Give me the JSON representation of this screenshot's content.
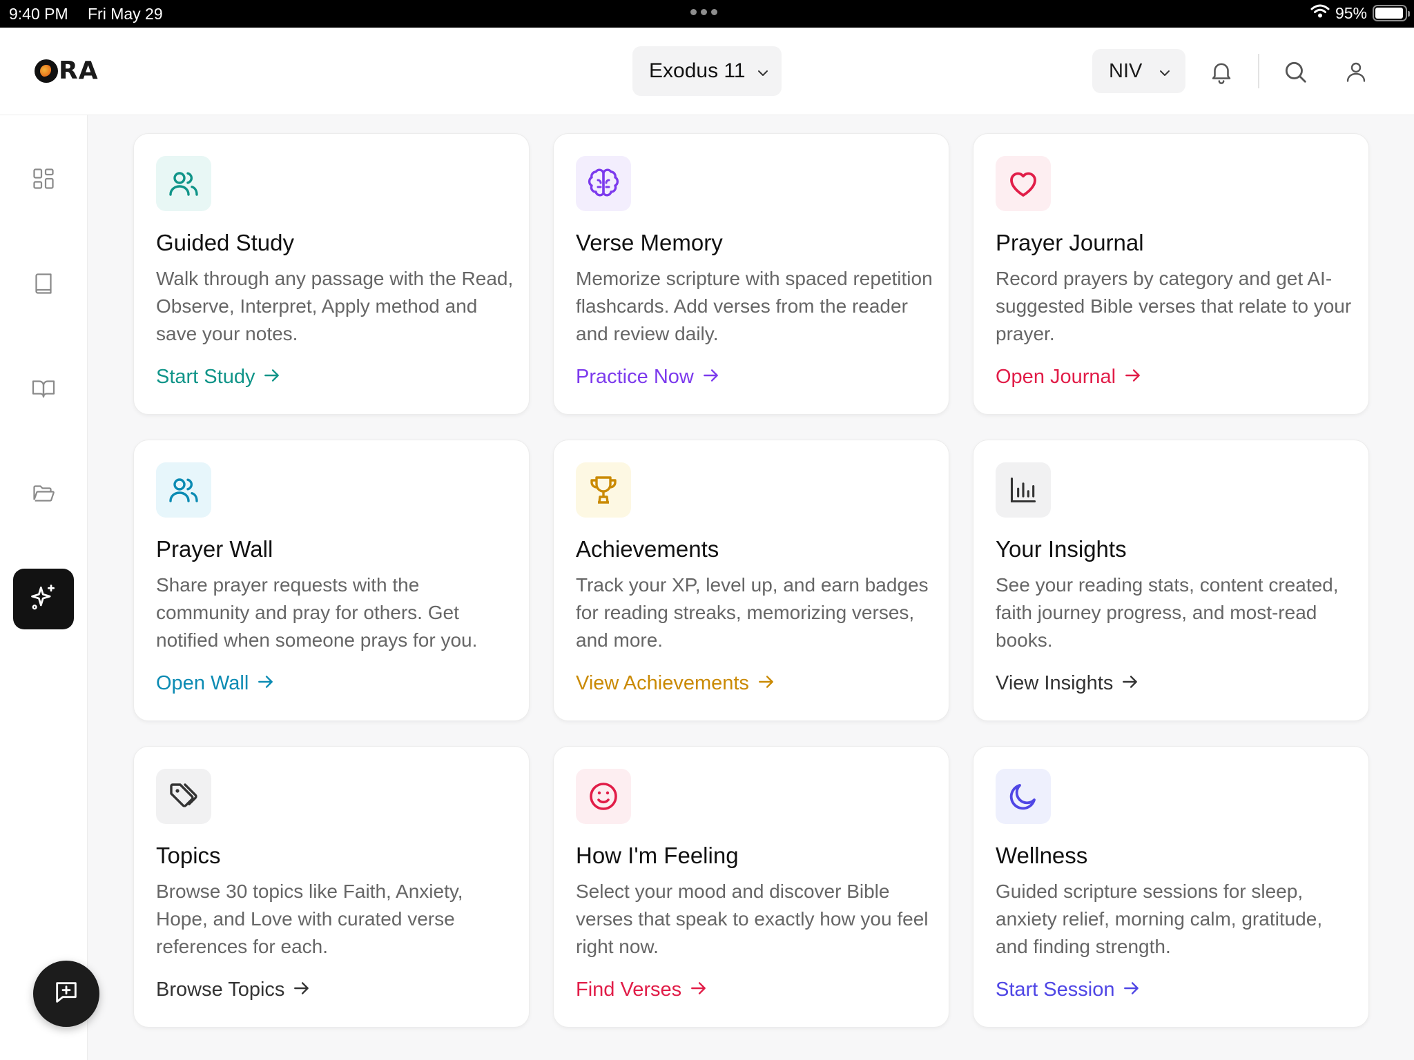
{
  "status_bar": {
    "time": "9:40 PM",
    "date": "Fri May 29",
    "battery": "95%",
    "battery_level": 0.95
  },
  "header": {
    "logo_text": "RA",
    "passage": "Exodus 11",
    "version": "NIV"
  },
  "sidebar": {
    "items": [
      "dashboard",
      "book",
      "open-book",
      "folder",
      "ai-sparkles"
    ]
  },
  "cards": [
    {
      "id": "guided-study",
      "title": "Guided Study",
      "description": "Walk through any passage with the Read, Observe, Interpret, Apply method and save your notes.",
      "action": "Start Study",
      "color": "#0f9488",
      "bg": "#e8f7f5",
      "icon": "users-icon"
    },
    {
      "id": "verse-memory",
      "title": "Verse Memory",
      "description": "Memorize scripture with spaced repetition flashcards. Add verses from the reader and review daily.",
      "action": "Practice Now",
      "color": "#7c3aed",
      "bg": "#f3eefd",
      "icon": "brain-icon"
    },
    {
      "id": "prayer-journal",
      "title": "Prayer Journal",
      "description": "Record prayers by category and get AI-suggested Bible verses that relate to your prayer.",
      "action": "Open Journal",
      "color": "#e11d48",
      "bg": "#fdeef1",
      "icon": "heart-icon"
    },
    {
      "id": "prayer-wall",
      "title": "Prayer Wall",
      "description": "Share prayer requests with the community and pray for others. Get notified when someone prays for you.",
      "action": "Open Wall",
      "color": "#0b8bb3",
      "bg": "#e7f6fb",
      "icon": "users-icon"
    },
    {
      "id": "achievements",
      "title": "Achievements",
      "description": "Track your XP, level up, and earn badges for reading streaks, memorizing verses, and more.",
      "action": "View Achievements",
      "color": "#ca8a04",
      "bg": "#fdf8e3",
      "icon": "trophy-icon"
    },
    {
      "id": "your-insights",
      "title": "Your Insights",
      "description": "See your reading stats, content created, faith journey progress, and most-read books.",
      "action": "View Insights",
      "color": "#333333",
      "bg": "#f1f1f2",
      "icon": "bar-chart-icon"
    },
    {
      "id": "topics",
      "title": "Topics",
      "description": "Browse 30 topics like Faith, Anxiety, Hope, and Love with curated verse references for each.",
      "action": "Browse Topics",
      "color": "#333333",
      "bg": "#f1f1f2",
      "icon": "tags-icon"
    },
    {
      "id": "how-im-feeling",
      "title": "How I'm Feeling",
      "description": "Select your mood and discover Bible verses that speak to exactly how you feel right now.",
      "action": "Find Verses",
      "color": "#e11d48",
      "bg": "#fdeef1",
      "icon": "smile-icon"
    },
    {
      "id": "wellness",
      "title": "Wellness",
      "description": "Guided scripture sessions for sleep, anxiety relief, morning calm, gratitude, and finding strength.",
      "action": "Start Session",
      "color": "#4f46e5",
      "bg": "#eef0fd",
      "icon": "moon-icon"
    }
  ]
}
